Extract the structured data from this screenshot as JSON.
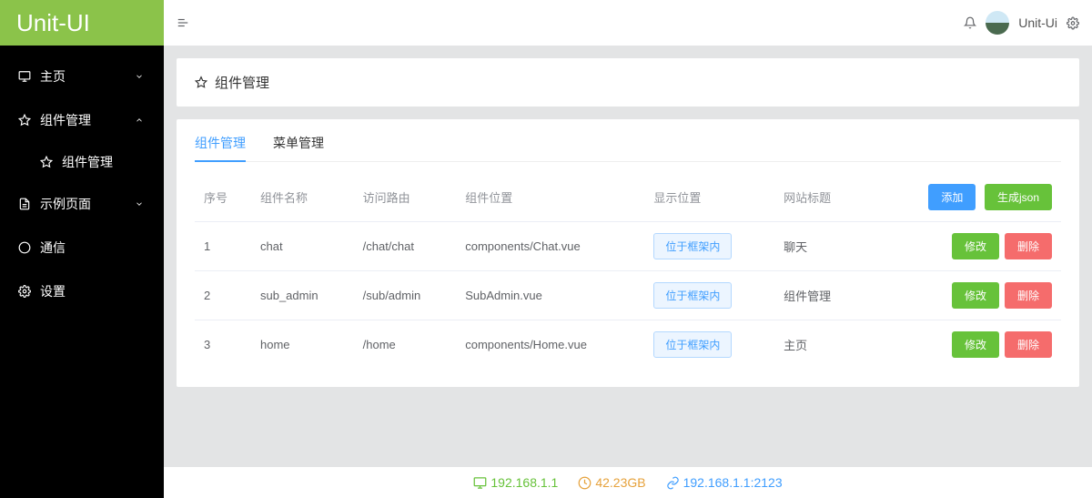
{
  "brand": "Unit-UI",
  "header": {
    "username": "Unit-Ui"
  },
  "sidebar": {
    "items": [
      {
        "label": "主页",
        "icon": "monitor",
        "expandable": true,
        "expanded": false
      },
      {
        "label": "组件管理",
        "icon": "star",
        "expandable": true,
        "expanded": true,
        "children": [
          {
            "label": "组件管理",
            "icon": "star"
          }
        ]
      },
      {
        "label": "示例页面",
        "icon": "document",
        "expandable": true,
        "expanded": false
      },
      {
        "label": "通信",
        "icon": "chat",
        "expandable": false
      },
      {
        "label": "设置",
        "icon": "gear",
        "expandable": false
      }
    ]
  },
  "page": {
    "title": "组件管理",
    "tabs": [
      {
        "label": "组件管理",
        "active": true
      },
      {
        "label": "菜单管理",
        "active": false
      }
    ],
    "columns": [
      "序号",
      "组件名称",
      "访问路由",
      "组件位置",
      "显示位置",
      "网站标题"
    ],
    "header_actions": {
      "add": "添加",
      "gen_json": "生成json"
    },
    "row_actions": {
      "edit": "修改",
      "del": "删除"
    },
    "rows": [
      {
        "idx": "1",
        "name": "chat",
        "route": "/chat/chat",
        "loc": "components/Chat.vue",
        "pos": "位于框架内",
        "title": "聊天"
      },
      {
        "idx": "2",
        "name": "sub_admin",
        "route": "/sub/admin",
        "loc": "SubAdmin.vue",
        "pos": "位于框架内",
        "title": "组件管理"
      },
      {
        "idx": "3",
        "name": "home",
        "route": "/home",
        "loc": "components/Home.vue",
        "pos": "位于框架内",
        "title": "主页"
      }
    ]
  },
  "footer": {
    "ip": "192.168.1.1",
    "storage": "42.23GB",
    "addr": "192.168.1.1:2123"
  }
}
